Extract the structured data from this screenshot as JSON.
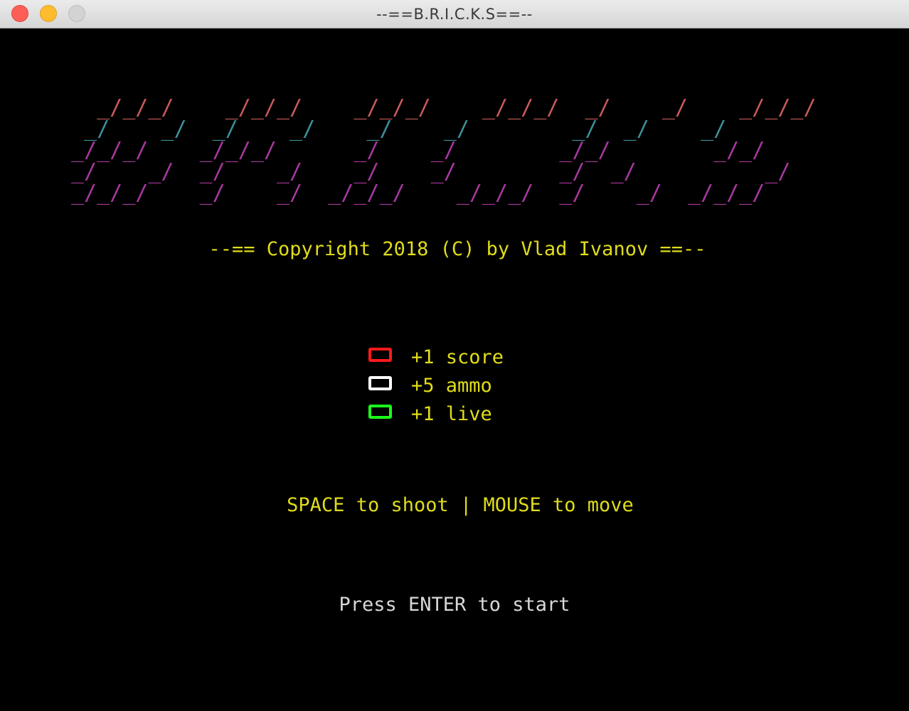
{
  "window": {
    "title": "--==B.R.I.C.K.S==--"
  },
  "logo": {
    "lines": [
      {
        "text": "  _/_/_/    _/_/_/    _/_/_/    _/_/_/  _/    _/    _/_/_/",
        "color": "#c95a5a"
      },
      {
        "text": " _/    _/  _/    _/    _/    _/        _/  _/    _/      ",
        "color": "#3f8f9a"
      },
      {
        "text": "_/_/_/    _/_/_/      _/    _/        _/_/        _/_/   ",
        "color": "#a8389f"
      },
      {
        "text": "_/    _/  _/    _/    _/    _/        _/  _/          _/ ",
        "color": "#a8389f"
      },
      {
        "text": "_/_/_/    _/    _/  _/_/_/    _/_/_/  _/    _/  _/_/_/   ",
        "color": "#a8389f"
      }
    ]
  },
  "copyright": "--== Copyright 2018 (C) by Vlad Ivanov ==--",
  "legend": {
    "items": [
      {
        "label": "+1 score",
        "color": "#ff1a1a"
      },
      {
        "label": "+5 ammo",
        "color": "#ffffff"
      },
      {
        "label": "+1 live",
        "color": "#1aff1a"
      }
    ]
  },
  "controls": "SPACE to shoot | MOUSE to move",
  "prompt": "Press ENTER to start",
  "colors": {
    "text_yellow": "#e0dc1a",
    "prompt_gray": "#d8d8d8",
    "background": "#000000"
  }
}
